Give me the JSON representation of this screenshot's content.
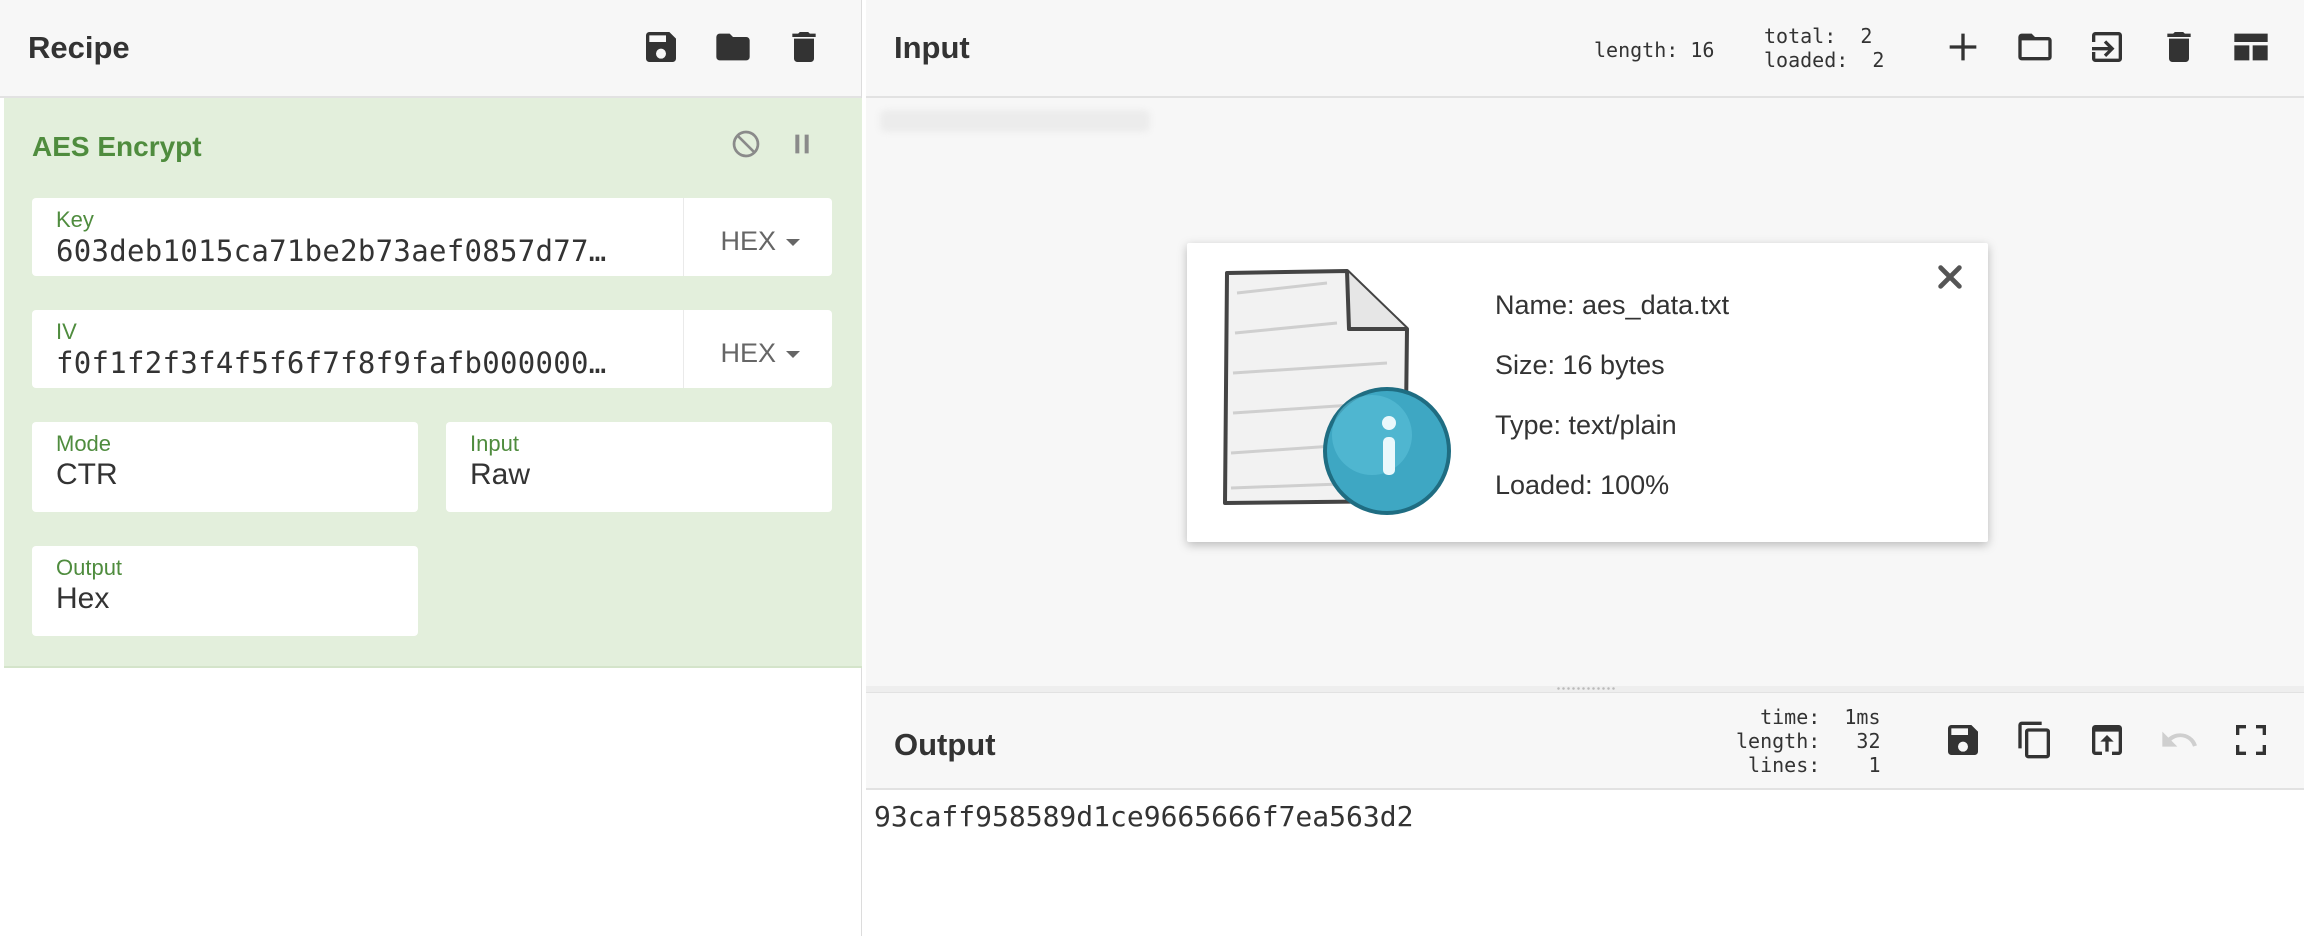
{
  "recipe": {
    "title": "Recipe",
    "toolbar": [
      "save-icon",
      "folder-icon",
      "trash-icon"
    ],
    "operation": {
      "name": "AES Encrypt",
      "controls": [
        "disable-icon",
        "pause-icon"
      ],
      "key": {
        "label": "Key",
        "value": "603deb1015ca71be2b73aef0857d77…",
        "format": "HEX"
      },
      "iv": {
        "label": "IV",
        "value": "f0f1f2f3f4f5f6f7f8f9fafb000000…",
        "format": "HEX"
      },
      "mode": {
        "label": "Mode",
        "value": "CTR"
      },
      "input": {
        "label": "Input",
        "value": "Raw"
      },
      "output": {
        "label": "Output",
        "value": "Hex"
      }
    }
  },
  "input": {
    "title": "Input",
    "stats_length": "length: 16",
    "stats_total": "total:  2",
    "stats_loaded": "loaded:  2",
    "toolbar": [
      "plus-icon",
      "open-folder-icon",
      "import-icon",
      "trash-icon",
      "layout-icon"
    ],
    "file": {
      "name": "Name: aes_data.txt",
      "size": "Size: 16 bytes",
      "type": "Type: text/plain",
      "loaded": "Loaded: 100%"
    }
  },
  "output": {
    "title": "Output",
    "stats_time": "  time:  1ms",
    "stats_length": "length:   32",
    "stats_lines": " lines:    1",
    "toolbar": [
      "save-icon",
      "copy-icon",
      "replace-input-icon",
      "undo-icon",
      "fullscreen-icon"
    ],
    "text": "93caff958589d1ce9665666f7ea563d2"
  }
}
